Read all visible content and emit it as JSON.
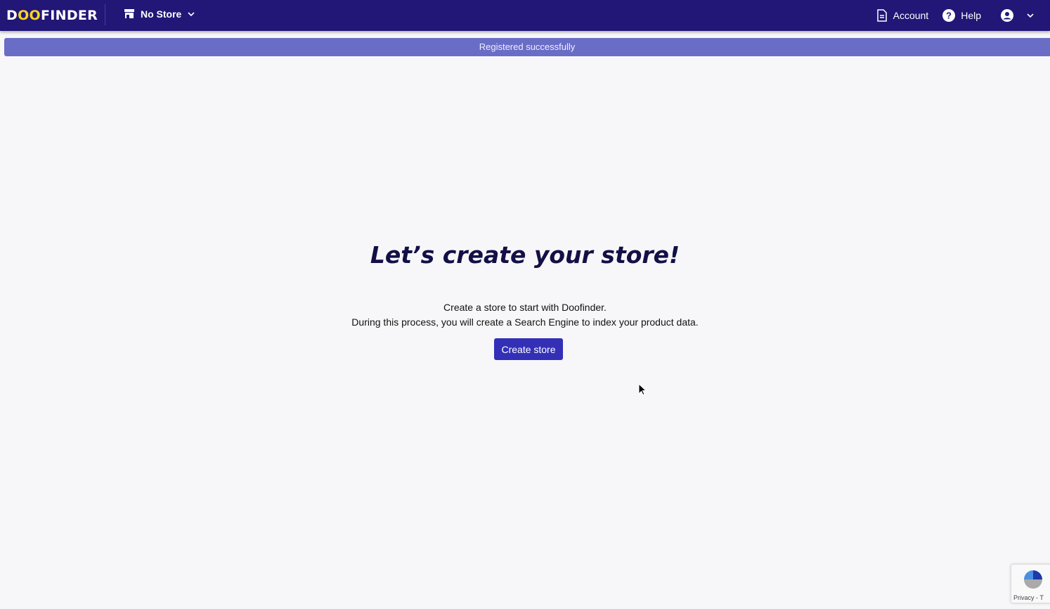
{
  "header": {
    "logo": {
      "pre": "D",
      "oo": "OO",
      "post": "FINDER"
    },
    "store_selector": "No Store",
    "account": "Account",
    "help": "Help"
  },
  "banner": {
    "text": "Registered successfully"
  },
  "main": {
    "title": "Let’s create your store!",
    "line1": "Create a store to start with Doofinder.",
    "line2": "During this process, you will create a Search Engine to index your product data.",
    "button": "Create store"
  },
  "recaptcha": {
    "text": "Privacy - T"
  },
  "colors": {
    "header": "#221677",
    "banner": "#6a6dc6",
    "button": "#3330b7",
    "logo_accent": "#f7d51d"
  }
}
